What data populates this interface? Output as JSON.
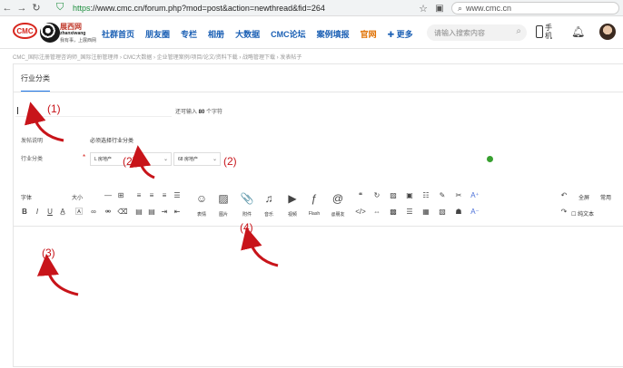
{
  "browser": {
    "url_https": "https",
    "url_rest": "://www.cmc.cn/forum.php?mod=post&action=newthread&fid=264",
    "search_value": "www.cmc.cn",
    "icons": [
      "back-icon",
      "forward-icon",
      "reload-icon",
      "shield-icon",
      "star-icon",
      "extensions-icon",
      "search-icon"
    ]
  },
  "header": {
    "logo_text": "CMC",
    "logo2_name": "展西网",
    "logo2_sub": "zhanxiwang",
    "logo2_slogan": "我有事，上展西网",
    "nav": [
      {
        "label": "社群首页",
        "color": "blue"
      },
      {
        "label": "朋友圈",
        "color": "blue"
      },
      {
        "label": "专栏",
        "color": "blue"
      },
      {
        "label": "相册",
        "color": "blue"
      },
      {
        "label": "大数据",
        "color": "blue"
      },
      {
        "label": "CMC论坛",
        "color": "blue"
      },
      {
        "label": "案例填报",
        "color": "blue"
      },
      {
        "label": "官网",
        "color": "orange"
      },
      {
        "label": "✚ 更多",
        "color": "blue"
      }
    ],
    "search_placeholder": "请输入搜索内容",
    "phone_label": "手机"
  },
  "breadcrumb": "CMC_国际注册管理咨询师_国际注册管理师  ›  CMC大数据  ›  企业管理案例/项目/论文/资料下载  ›  战略管理下载  ›  发表帖子",
  "form": {
    "tab": "行业分类",
    "char_count_prefix": "还可输入 ",
    "char_count_num": "80",
    "char_count_suffix": " 个字符",
    "notice_label": "发帖说明",
    "notice_value": "必须选择行业分类",
    "category_label": "行业分类",
    "select1": "L 房地产",
    "select2": "68 房地产"
  },
  "toolbar": {
    "font_label": "字体",
    "size_label": "大小",
    "big_buttons": [
      {
        "label": "表情",
        "icon": "☺",
        "name": "emoji-button"
      },
      {
        "label": "图片",
        "icon": "▨",
        "name": "image-button"
      },
      {
        "label": "附件",
        "icon": "📎",
        "name": "attachment-button"
      },
      {
        "label": "音乐",
        "icon": "♫",
        "name": "music-button"
      },
      {
        "label": "视频",
        "icon": "▶",
        "name": "video-button"
      },
      {
        "label": "Flash",
        "icon": "ƒ",
        "name": "flash-button"
      },
      {
        "label": "@朋友",
        "icon": "@",
        "name": "mention-button"
      }
    ],
    "fullscreen_label": "全屏",
    "common_label": "常用",
    "plaintext_label": "纯文本"
  },
  "annotations": [
    "(1)",
    "(2)",
    "(2)",
    "(3)",
    "(4)"
  ],
  "colors": {
    "annotation": "#c8141a",
    "nav_blue": "#1a5fb4",
    "nav_orange": "#e07000",
    "tab_underline": "#1a73e8"
  }
}
